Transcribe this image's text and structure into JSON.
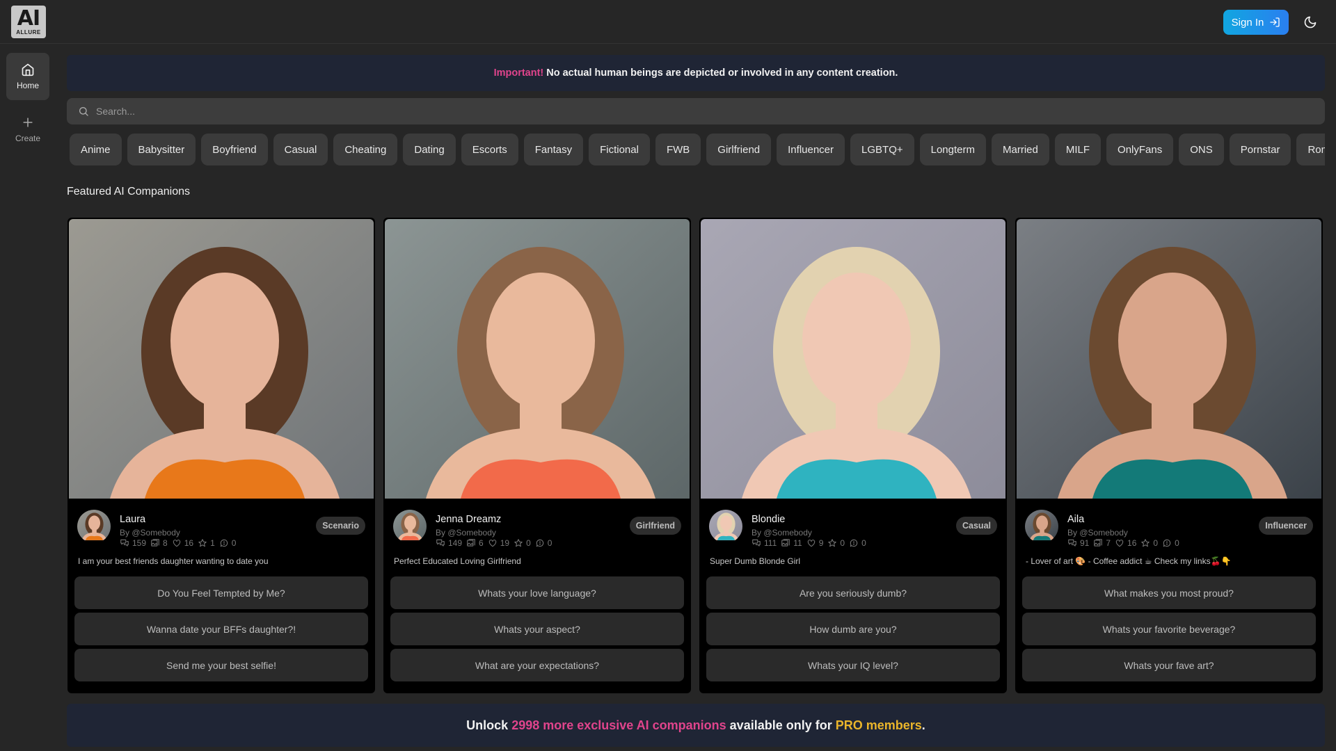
{
  "header": {
    "logo_text": "AI",
    "logo_subtext": "ALLURE",
    "sign_in_label": "Sign In",
    "theme_icon": "moon-icon"
  },
  "sidebar": {
    "items": [
      {
        "label": "Home",
        "icon": "home-icon",
        "active": true
      },
      {
        "label": "Create",
        "icon": "plus-icon",
        "active": false
      }
    ]
  },
  "notice": {
    "highlight": "Important!",
    "text": "No actual human beings are depicted or involved in any content creation.",
    "highlight_color": "#e0448c"
  },
  "search": {
    "placeholder": "Search...",
    "value": ""
  },
  "categories": [
    "Anime",
    "Babysitter",
    "Boyfriend",
    "Casual",
    "Cheating",
    "Dating",
    "Escorts",
    "Fantasy",
    "Fictional",
    "FWB",
    "Girlfriend",
    "Influencer",
    "LGBTQ+",
    "Longterm",
    "Married",
    "MILF",
    "OnlyFans",
    "ONS",
    "Pornstar",
    "Romance"
  ],
  "featured": {
    "title": "Featured AI Companions",
    "cards": [
      {
        "name": "Laura",
        "by": "By @Somebody",
        "badge": "Scenario",
        "stats": {
          "chats": "159",
          "images": "8",
          "likes": "16",
          "favorites": "1",
          "comments": "0"
        },
        "description": "I am your best friends daughter wanting to date you",
        "prompts": [
          "Do You Feel Tempted by Me?",
          "Wanna date your BFFs daughter?!",
          "Send me your best selfie!"
        ]
      },
      {
        "name": "Jenna Dreamz",
        "by": "By @Somebody",
        "badge": "Girlfriend",
        "stats": {
          "chats": "149",
          "images": "6",
          "likes": "19",
          "favorites": "0",
          "comments": "0"
        },
        "description": "Perfect Educated Loving Girlfriend",
        "prompts": [
          "Whats your love language?",
          "Whats your aspect?",
          "What are your expectations?"
        ]
      },
      {
        "name": "Blondie",
        "by": "By @Somebody",
        "badge": "Casual",
        "stats": {
          "chats": "111",
          "images": "11",
          "likes": "9",
          "favorites": "0",
          "comments": "0"
        },
        "description": "Super Dumb Blonde Girl",
        "prompts": [
          "Are you seriously dumb?",
          "How dumb are you?",
          "Whats your IQ level?"
        ]
      },
      {
        "name": "Aila",
        "by": "By @Somebody",
        "badge": "Influencer",
        "stats": {
          "chats": "91",
          "images": "7",
          "likes": "16",
          "favorites": "0",
          "comments": "0"
        },
        "description": "- Lover of art 🎨 - Coffee addict ☕ Check my links🍒👇",
        "prompts": [
          "What makes you most proud?",
          "Whats your favorite beverage?",
          "Whats your fave art?"
        ]
      }
    ]
  },
  "unlock": {
    "prefix": "Unlock",
    "highlight": "2998 more exclusive AI companions",
    "middle": "available only for",
    "pro": "PRO members",
    "suffix": ".",
    "highlight_color": "#e0448c",
    "pro_color": "#eab52b"
  }
}
